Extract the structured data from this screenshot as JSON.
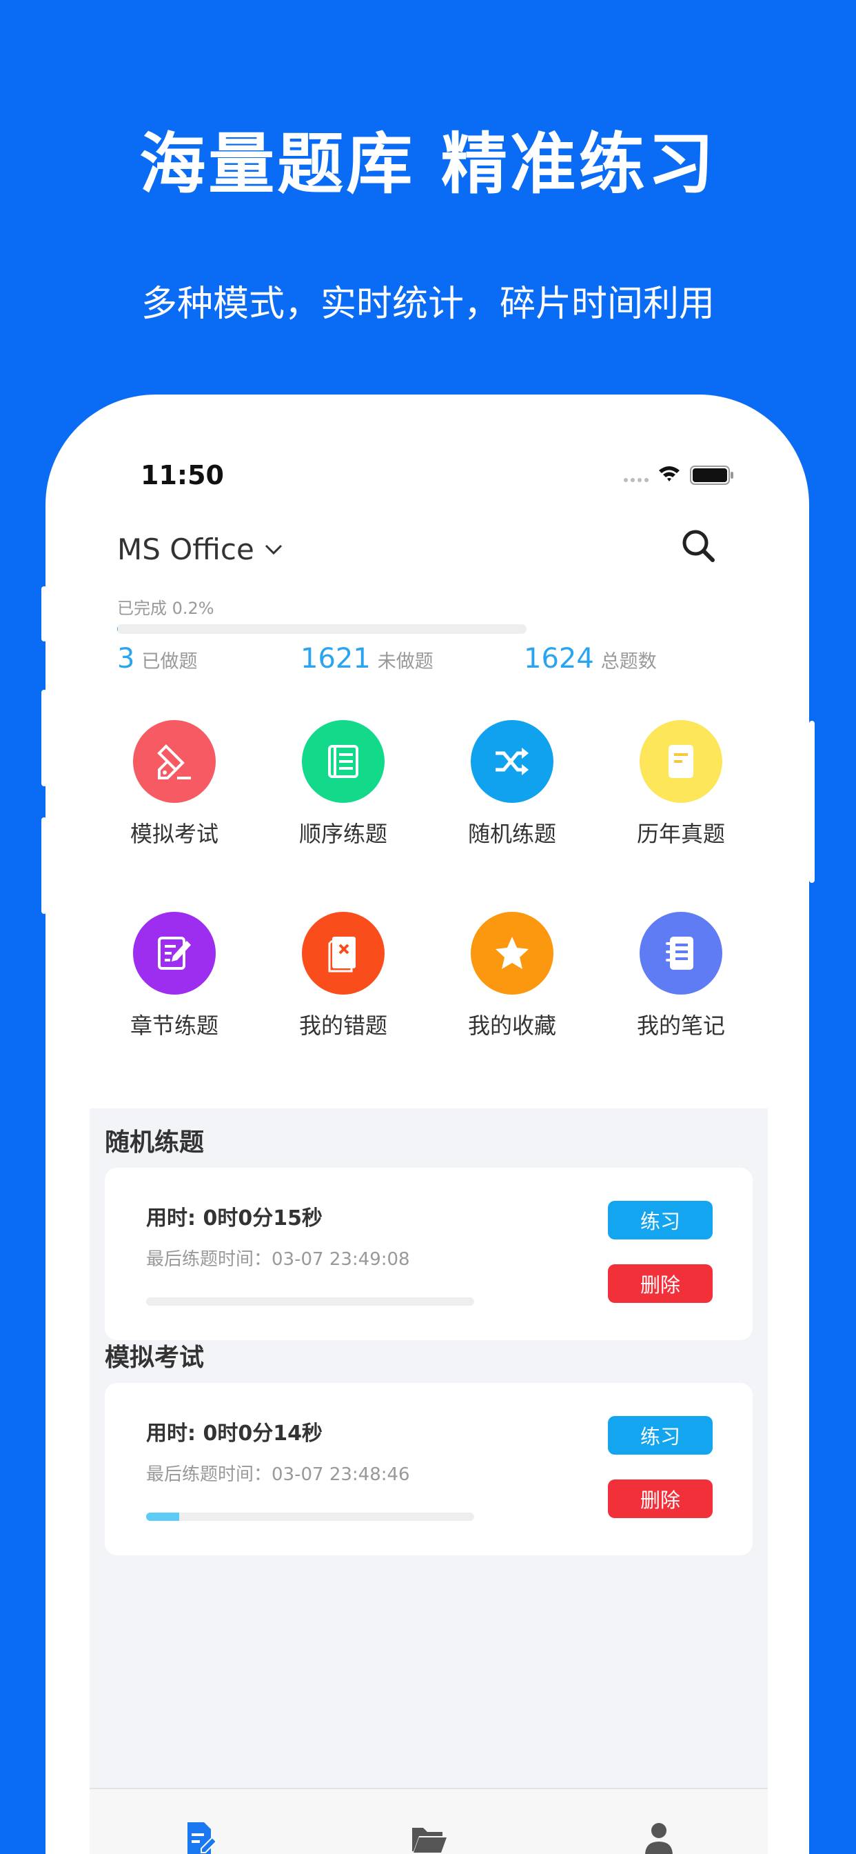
{
  "promo": {
    "headline": "海量题库 精准练习",
    "subline": "多种模式，实时统计，碎片时间利用"
  },
  "status_bar": {
    "time": "11:50"
  },
  "header": {
    "subject": "MS Office"
  },
  "progress": {
    "label": "已完成 0.2%",
    "percent": 0.2
  },
  "stats": [
    {
      "value": "3",
      "label": "已做题"
    },
    {
      "value": "1621",
      "label": "未做题"
    },
    {
      "value": "1624",
      "label": "总题数"
    }
  ],
  "modules": [
    {
      "label": "模拟考试",
      "icon": "pen-nib-icon",
      "color": "#f65b63"
    },
    {
      "label": "顺序练题",
      "icon": "list-icon",
      "color": "#13d98a"
    },
    {
      "label": "随机练题",
      "icon": "shuffle-icon",
      "color": "#10a2ef"
    },
    {
      "label": "历年真题",
      "icon": "paper-icon",
      "color": "#fde65a"
    },
    {
      "label": "章节练题",
      "icon": "edit-icon",
      "color": "#9d2ef0"
    },
    {
      "label": "我的错题",
      "icon": "wrong-book-icon",
      "color": "#fa4d1c"
    },
    {
      "label": "我的收藏",
      "icon": "star-icon",
      "color": "#fc9810"
    },
    {
      "label": "我的笔记",
      "icon": "notebook-icon",
      "color": "#5f7cf5"
    }
  ],
  "records": [
    {
      "title": "随机练题",
      "time_used": "用时: 0时0分15秒",
      "last_time": "最后练题时间：03-07 23:49:08",
      "progress": 0,
      "practice_label": "练习",
      "delete_label": "删除"
    },
    {
      "title": "模拟考试",
      "time_used": "用时: 0时0分14秒",
      "last_time": "最后练题时间：03-07 23:48:46",
      "progress": 0.1,
      "practice_label": "练习",
      "delete_label": "删除"
    }
  ],
  "tabbar": [
    {
      "icon": "practice-doc-icon",
      "color": "#1a78f0"
    },
    {
      "icon": "folder-icon",
      "color": "#555555"
    },
    {
      "icon": "user-icon",
      "color": "#555555"
    }
  ]
}
